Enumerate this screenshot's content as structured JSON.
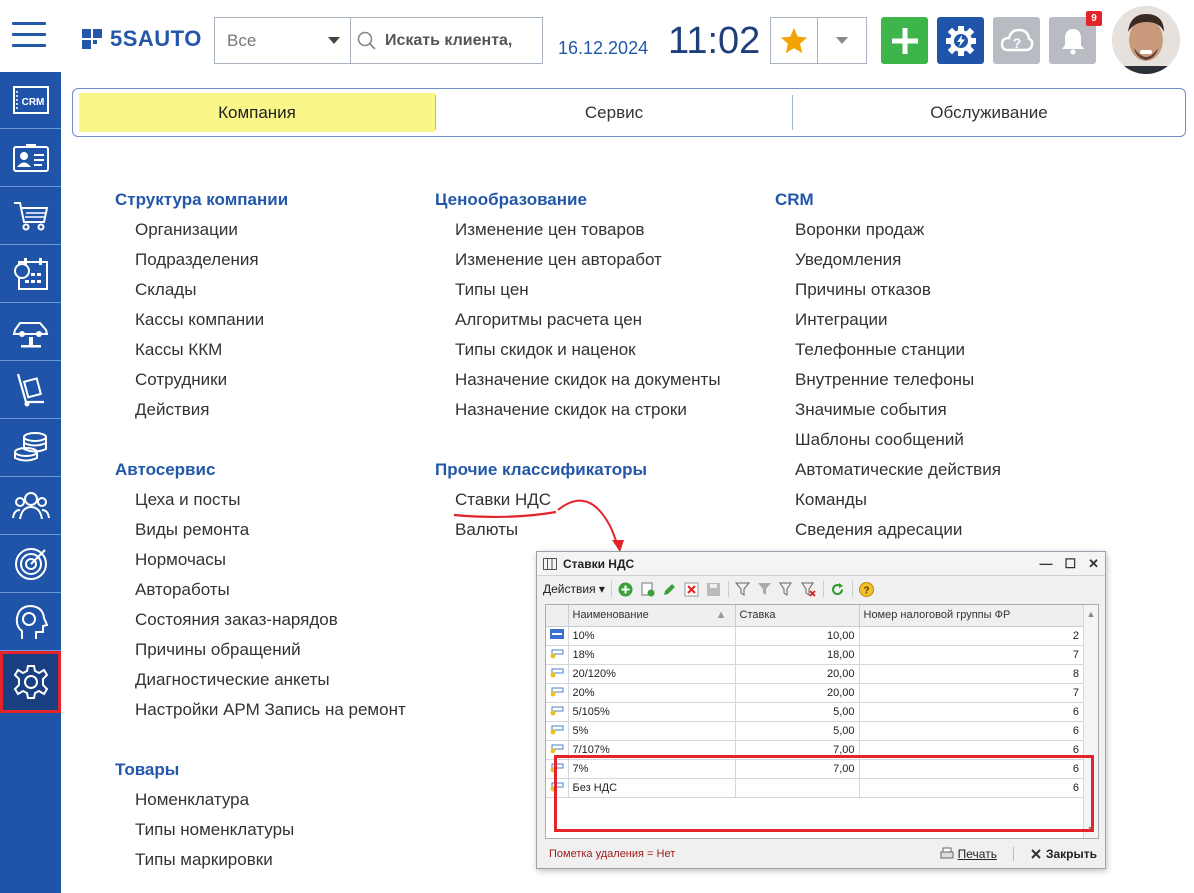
{
  "header": {
    "logo_text": "5SAUTO",
    "search_select": "Все",
    "search_placeholder": "Искать клиента,",
    "date": "16.12.2024",
    "time": "11:02",
    "notification_count": "9"
  },
  "sidebar": {
    "items": [
      {
        "icon": "crm-icon",
        "label": "CRM"
      },
      {
        "icon": "client-card-icon"
      },
      {
        "icon": "cart-icon"
      },
      {
        "icon": "calendar-icon"
      },
      {
        "icon": "car-lift-icon"
      },
      {
        "icon": "warehouse-cart-icon"
      },
      {
        "icon": "coins-icon"
      },
      {
        "icon": "users-icon"
      },
      {
        "icon": "target-icon"
      },
      {
        "icon": "head-profile-icon"
      },
      {
        "icon": "settings-gear-icon",
        "active": true
      }
    ]
  },
  "tabs": [
    {
      "label": "Компания",
      "active": true
    },
    {
      "label": "Сервис"
    },
    {
      "label": "Обслуживание"
    }
  ],
  "columns": {
    "col1": {
      "groups": [
        {
          "title": "Структура компании",
          "links": [
            "Организации",
            "Подразделения",
            "Склады",
            "Кассы компании",
            "Кассы ККМ",
            "Сотрудники",
            "Действия"
          ]
        },
        {
          "title": "Автосервис",
          "links": [
            "Цеха и посты",
            "Виды ремонта",
            "Нормочасы",
            "Автоработы",
            "Состояния заказ-нарядов",
            "Причины обращений",
            "Диагностические анкеты",
            "Настройки АРМ Запись на ремонт"
          ]
        },
        {
          "title": "Товары",
          "links": [
            "Номенклатура",
            "Типы номенклатуры",
            "Типы маркировки"
          ]
        }
      ]
    },
    "col2": {
      "groups": [
        {
          "title": "Ценообразование",
          "links": [
            "Изменение цен товаров",
            "Изменение цен авторабот",
            "Типы цен",
            "Алгоритмы расчета цен",
            "Типы скидок и наценок",
            "Назначение скидок на документы",
            "Назначение скидок на строки"
          ]
        },
        {
          "title": "Прочие классификаторы",
          "links": [
            "Ставки НДС",
            "Валюты"
          ]
        }
      ]
    },
    "col3": {
      "groups": [
        {
          "title": "CRM",
          "links": [
            "Воронки продаж",
            "Уведомления",
            "Причины отказов",
            "Интеграции",
            "Телефонные станции",
            "Внутренние телефоны",
            "Значимые события",
            "Шаблоны сообщений",
            "Автоматические действия",
            "Команды",
            "Сведения адресации"
          ]
        }
      ]
    }
  },
  "dialog": {
    "title": "Ставки НДС",
    "toolbar_actions": "Действия",
    "columns": [
      "Наименование",
      "Ставка",
      "Номер налоговой группы ФР"
    ],
    "rows": [
      {
        "name": "10%",
        "rate": "10,00",
        "group": "2"
      },
      {
        "name": "18%",
        "rate": "18,00",
        "group": "7"
      },
      {
        "name": "20/120%",
        "rate": "20,00",
        "group": "8"
      },
      {
        "name": "20%",
        "rate": "20,00",
        "group": "7"
      },
      {
        "name": "5/105%",
        "rate": "5,00",
        "group": "6"
      },
      {
        "name": "5%",
        "rate": "5,00",
        "group": "6"
      },
      {
        "name": "7/107%",
        "rate": "7,00",
        "group": "6"
      },
      {
        "name": "7%",
        "rate": "7,00",
        "group": "6"
      },
      {
        "name": "Без НДС",
        "rate": "",
        "group": "6"
      }
    ],
    "footer_status": "Пометка удаления = Нет",
    "print_label": "Печать",
    "close_label": "Закрыть"
  },
  "colors": {
    "brand_blue": "#2357a9",
    "active_tab": "#fbf688",
    "highlight_red": "#e3242b",
    "add_green": "#3db54a"
  }
}
